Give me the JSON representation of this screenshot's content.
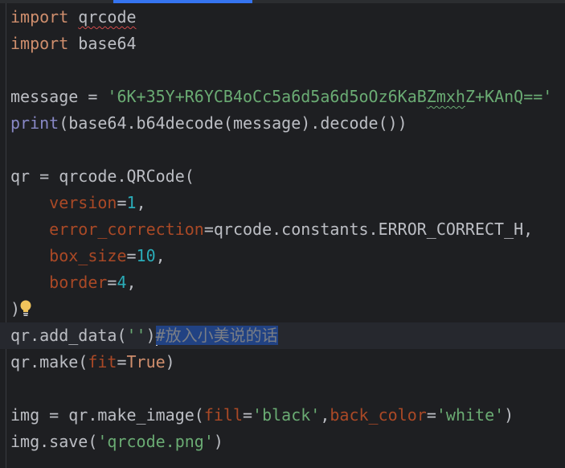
{
  "editor": {
    "lines": [
      [
        [
          "import ",
          "kw"
        ],
        [
          "qrcode",
          "plain typo"
        ]
      ],
      [
        [
          "import ",
          "kw"
        ],
        [
          "base64",
          "plain"
        ]
      ],
      [],
      [
        [
          "message = ",
          "plain"
        ],
        [
          "'6K+35Y+R6YCB4oCc5a6d5a6d5oOz6KaB",
          "str"
        ],
        [
          "Zmxh",
          "str typo-g"
        ],
        [
          "Z+KAnQ=='",
          "str"
        ]
      ],
      [
        [
          "print",
          "builtin"
        ],
        [
          "(base64.b64decode(message).decode())",
          "plain"
        ]
      ],
      [],
      [
        [
          "qr = qrcode.QRCode(",
          "plain"
        ]
      ],
      [
        [
          "    ",
          "plain"
        ],
        [
          "version",
          "param"
        ],
        [
          "=",
          "plain"
        ],
        [
          "1",
          "num"
        ],
        [
          ",",
          "plain"
        ]
      ],
      [
        [
          "    ",
          "plain"
        ],
        [
          "error_correction",
          "param"
        ],
        [
          "=qrcode.constants.ERROR_CORRECT_H,",
          "plain"
        ]
      ],
      [
        [
          "    ",
          "plain"
        ],
        [
          "box_size",
          "param"
        ],
        [
          "=",
          "plain"
        ],
        [
          "10",
          "num"
        ],
        [
          ",",
          "plain"
        ]
      ],
      [
        [
          "    ",
          "plain"
        ],
        [
          "border",
          "param"
        ],
        [
          "=",
          "plain"
        ],
        [
          "4",
          "num"
        ],
        [
          ",",
          "plain"
        ]
      ],
      [
        [
          ")",
          "plain"
        ]
      ],
      [
        [
          "qr.add_data(",
          "plain"
        ],
        [
          "''",
          "str"
        ],
        [
          ")",
          "plain"
        ],
        [
          "#放入小美说的话",
          "cmt sel"
        ]
      ],
      [
        [
          "qr.make(",
          "plain"
        ],
        [
          "fit",
          "param"
        ],
        [
          "=",
          "plain"
        ],
        [
          "True",
          "kw"
        ],
        [
          ")",
          "plain"
        ]
      ],
      [],
      [
        [
          "img = qr.make_image(",
          "plain"
        ],
        [
          "fill",
          "param"
        ],
        [
          "=",
          "plain"
        ],
        [
          "'black'",
          "str"
        ],
        [
          ",",
          "plain"
        ],
        [
          "back_color",
          "param"
        ],
        [
          "=",
          "plain"
        ],
        [
          "'white'",
          "str"
        ],
        [
          ")",
          "plain"
        ]
      ],
      [
        [
          "img.save(",
          "plain"
        ],
        [
          "'qrcode.png'",
          "str"
        ],
        [
          ")",
          "plain"
        ]
      ]
    ],
    "current_line": 12,
    "bulb_line": 11,
    "icons": {
      "bulb": "lightbulb-icon"
    }
  }
}
